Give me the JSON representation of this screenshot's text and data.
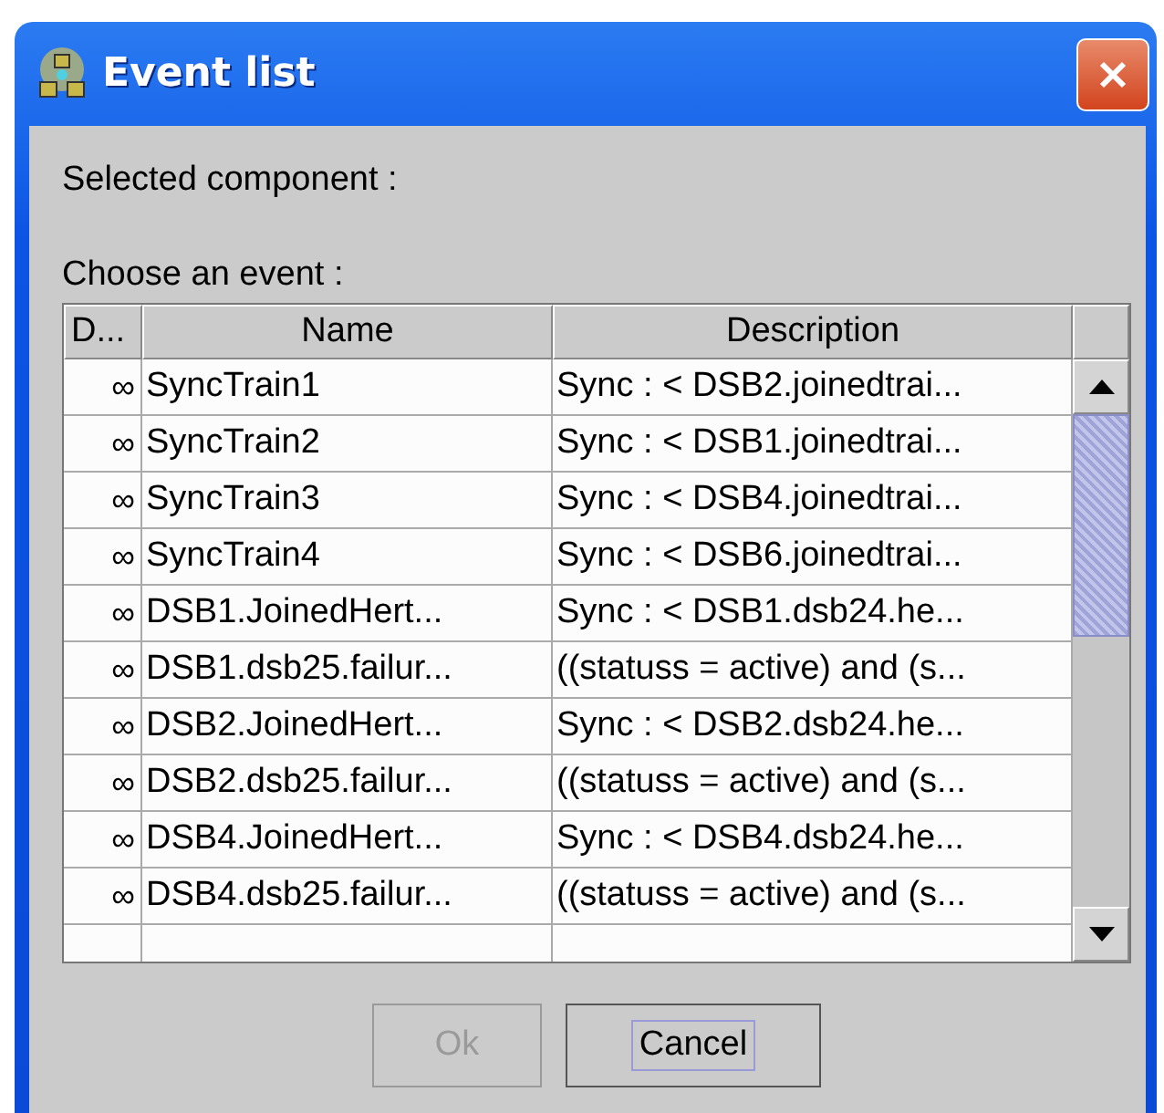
{
  "window": {
    "title": "Event list"
  },
  "selected_component_label": "Selected component :",
  "choose_label": "Choose an event :",
  "table": {
    "columns": [
      "D...",
      "Name",
      "Description"
    ],
    "rows": [
      {
        "d": "∞",
        "name": "SyncTrain1",
        "description": "Sync : < DSB2.joinedtrai..."
      },
      {
        "d": "∞",
        "name": "SyncTrain2",
        "description": "Sync : < DSB1.joinedtrai..."
      },
      {
        "d": "∞",
        "name": "SyncTrain3",
        "description": "Sync : < DSB4.joinedtrai..."
      },
      {
        "d": "∞",
        "name": "SyncTrain4",
        "description": "Sync : < DSB6.joinedtrai..."
      },
      {
        "d": "∞",
        "name": "DSB1.JoinedHert...",
        "description": "Sync : < DSB1.dsb24.he..."
      },
      {
        "d": "∞",
        "name": "DSB1.dsb25.failur...",
        "description": "((statuss = active) and (s..."
      },
      {
        "d": "∞",
        "name": "DSB2.JoinedHert...",
        "description": "Sync : < DSB2.dsb24.he..."
      },
      {
        "d": "∞",
        "name": "DSB2.dsb25.failur...",
        "description": "((statuss = active) and (s..."
      },
      {
        "d": "∞",
        "name": "DSB4.JoinedHert...",
        "description": "Sync : < DSB4.dsb24.he..."
      },
      {
        "d": "∞",
        "name": "DSB4.dsb25.failur...",
        "description": "((statuss = active) and (s..."
      }
    ]
  },
  "buttons": [
    {
      "label": "Ok",
      "disabled": true,
      "focused": false
    },
    {
      "label": "Cancel",
      "disabled": false,
      "focused": true
    }
  ]
}
